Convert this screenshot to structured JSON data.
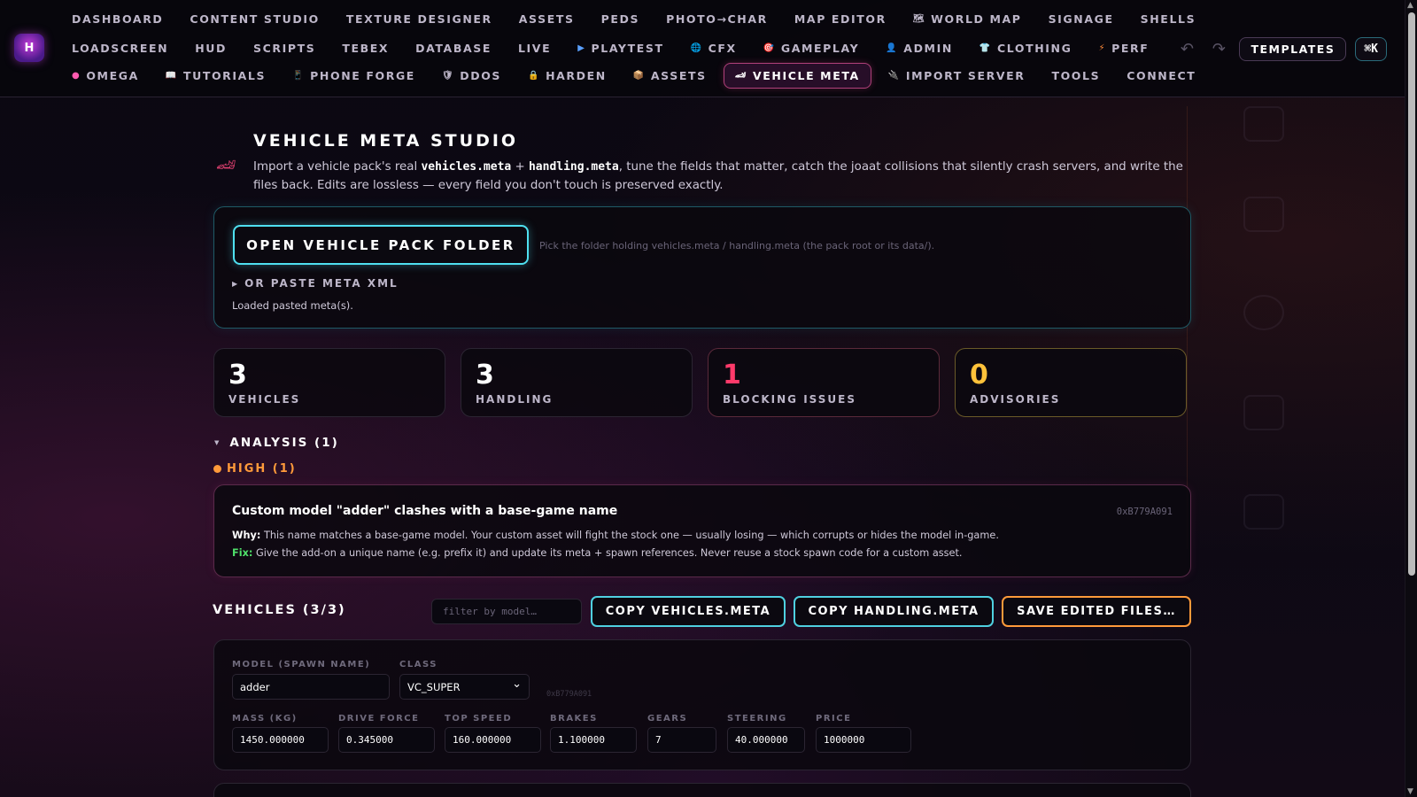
{
  "nav": {
    "logo_text": "H",
    "row1": [
      {
        "label": "DASHBOARD",
        "icon": ""
      },
      {
        "label": "CONTENT STUDIO",
        "icon": ""
      },
      {
        "label": "TEXTURE DESIGNER",
        "icon": ""
      },
      {
        "label": "ASSETS",
        "icon": ""
      },
      {
        "label": "PEDS",
        "icon": ""
      },
      {
        "label": "PHOTO→CHAR",
        "icon": ""
      },
      {
        "label": "MAP EDITOR",
        "icon": ""
      },
      {
        "label": "WORLD MAP",
        "icon": "🗺"
      },
      {
        "label": "SIGNAGE",
        "icon": ""
      },
      {
        "label": "SHELLS",
        "icon": ""
      }
    ],
    "row2": [
      {
        "label": "LOADSCREEN",
        "icon": ""
      },
      {
        "label": "HUD",
        "icon": ""
      },
      {
        "label": "SCRIPTS",
        "icon": ""
      },
      {
        "label": "TEBEX",
        "icon": ""
      },
      {
        "label": "DATABASE",
        "icon": ""
      },
      {
        "label": "LIVE",
        "icon": ""
      },
      {
        "label": "PLAYTEST",
        "icon": "▶"
      },
      {
        "label": "CFX",
        "icon": "🌐"
      },
      {
        "label": "GAMEPLAY",
        "icon": "🎯"
      },
      {
        "label": "ADMIN",
        "icon": "👤"
      },
      {
        "label": "CLOTHING",
        "icon": "👕"
      },
      {
        "label": "PERF",
        "icon": "⚡"
      }
    ],
    "row3": [
      {
        "label": "OMEGA",
        "icon": "●",
        "active": false
      },
      {
        "label": "TUTORIALS",
        "icon": "📖",
        "active": false
      },
      {
        "label": "PHONE FORGE",
        "icon": "📱",
        "active": false
      },
      {
        "label": "DDOS",
        "icon": "🛡",
        "active": false
      },
      {
        "label": "HARDEN",
        "icon": "🔒",
        "active": false
      },
      {
        "label": "ASSETS",
        "icon": "📦",
        "active": false
      },
      {
        "label": "VEHICLE META",
        "icon": "🏎",
        "active": true
      },
      {
        "label": "IMPORT SERVER",
        "icon": "🔌",
        "active": false
      },
      {
        "label": "TOOLS",
        "icon": "",
        "active": false
      },
      {
        "label": "CONNECT",
        "icon": "",
        "active": false
      }
    ],
    "undo_icon": "↶",
    "redo_icon": "↷",
    "templates_label": "TEMPLATES",
    "shortcut_label": "⌘K"
  },
  "header": {
    "icon": "🏎",
    "title": "VEHICLE META STUDIO",
    "desc_1": "Import a vehicle pack's real ",
    "code_1": "vehicles.meta",
    "desc_2": " + ",
    "code_2": "handling.meta",
    "desc_3": ", tune the fields that matter, catch the joaat collisions that silently crash servers, and write the files back. Edits are lossless — every field you don't touch is preserved exactly."
  },
  "open_panel": {
    "button_label": "OPEN VEHICLE PACK FOLDER",
    "hint": "Pick the folder holding vehicles.meta / handling.meta (the pack root or its data/).",
    "paste_label": "OR PASTE META XML",
    "status": "Loaded pasted meta(s)."
  },
  "stats": [
    {
      "value": "3",
      "label": "VEHICLES"
    },
    {
      "value": "3",
      "label": "HANDLING"
    },
    {
      "value": "1",
      "label": "BLOCKING ISSUES"
    },
    {
      "value": "0",
      "label": "ADVISORIES"
    }
  ],
  "analysis": {
    "label": "ANALYSIS (1)",
    "severity_label": "HIGH (1)",
    "issue": {
      "title": "Custom model \"adder\" clashes with a base-game name",
      "hash": "0xB779A091",
      "why_label": "Why:",
      "why": " This name matches a base-game model. Your custom asset will fight the stock one — usually losing — which corrupts or hides the model in-game.",
      "fix_label": "Fix:",
      "fix": " Give the add-on a unique name (e.g. prefix it) and update its meta + spawn references. Never reuse a stock spawn code for a custom asset."
    }
  },
  "vehicles": {
    "title": "VEHICLES (3/3)",
    "filter_placeholder": "filter by model…",
    "copy_vehicles_label": "COPY VEHICLES.META",
    "copy_handling_label": "COPY HANDLING.META",
    "save_label": "SAVE EDITED FILES…",
    "card": {
      "model_label": "MODEL (SPAWN NAME)",
      "model_value": "adder",
      "class_label": "CLASS",
      "class_value": "VC_SUPER",
      "hash": "0xB779A091",
      "fields": [
        {
          "label": "MASS (KG)",
          "value": "1450.000000"
        },
        {
          "label": "DRIVE FORCE",
          "value": "0.345000"
        },
        {
          "label": "TOP SPEED",
          "value": "160.000000"
        },
        {
          "label": "BRAKES",
          "value": "1.100000"
        },
        {
          "label": "GEARS",
          "value": "7"
        },
        {
          "label": "STEERING",
          "value": "40.000000"
        },
        {
          "label": "PRICE",
          "value": "1000000"
        }
      ]
    }
  }
}
